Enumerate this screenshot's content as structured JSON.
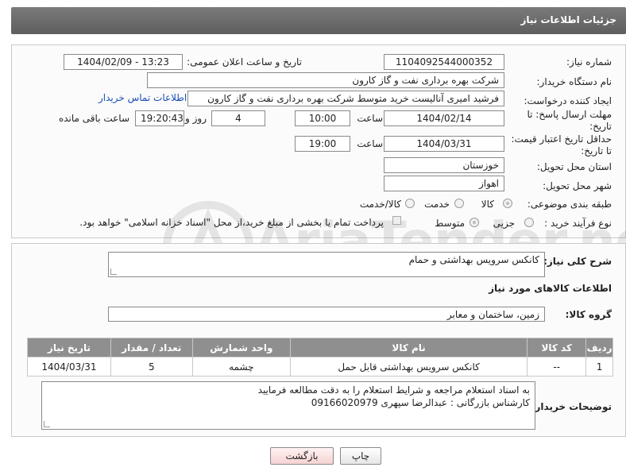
{
  "header": {
    "title": "جزئیات اطلاعات نیاز"
  },
  "form": {
    "need_number": {
      "label": "شماره نیاز:",
      "value": "1104092544000352"
    },
    "announce_datetime": {
      "label": "تاریخ و ساعت اعلان عمومی:",
      "value": "1404/02/09 - 13:23"
    },
    "buyer_org": {
      "label": "نام دستگاه خریدار:",
      "value": "شرکت بهره برداری نفت و گاز کارون"
    },
    "requester": {
      "label": "ایجاد کننده درخواست:",
      "value": "فرشید امیری آنالیست خرید متوسط شرکت بهره برداری نفت و گاز کارون"
    },
    "buyer_contact_link": "اطلاعات تماس خریدار",
    "reply_deadline": {
      "label": "مهلت ارسال پاسخ: تا تاریخ:",
      "date": "1404/02/14",
      "time_label": "ساعت",
      "time": "10:00",
      "days": "4",
      "days_label": "روز و",
      "remaining": "19:20:43",
      "remaining_label": "ساعت باقی مانده"
    },
    "price_validity": {
      "label": "حداقل تاریخ اعتبار قیمت: تا تاریخ:",
      "date": "1404/03/31",
      "time_label": "ساعت",
      "time": "19:00"
    },
    "province": {
      "label": "استان محل تحویل:",
      "value": "خوزستان"
    },
    "city": {
      "label": "شهر محل تحویل:",
      "value": "اهواز"
    },
    "category": {
      "label": "طبقه بندی موضوعی:",
      "options": [
        "کالا",
        "خدمت",
        "کالا/خدمت"
      ],
      "selected": "کالا"
    },
    "process_type": {
      "label": "نوع فرآیند خرید :",
      "options": [
        "جزیی",
        "متوسط"
      ],
      "selected": "متوسط",
      "payment_note": "پرداخت تمام یا بخشی از مبلغ خرید،از محل \"اسناد خزانه اسلامی\" خواهد بود."
    }
  },
  "description": {
    "label": "شرح کلی نیاز:",
    "value": "کانکس سرویس بهداشتی و حمام"
  },
  "goods_info_title": "اطلاعات کالاهای مورد نیاز",
  "goods_group": {
    "label": "گروه کالا:",
    "value": "زمین، ساختمان و معابر"
  },
  "table": {
    "headers": [
      "ردیف",
      "کد کالا",
      "نام کالا",
      "واحد شمارش",
      "تعداد / مقدار",
      "تاریخ نیاز"
    ],
    "rows": [
      [
        "1",
        "--",
        "کانکس سرویس بهداشتی قابل حمل",
        "چشمه",
        "5",
        "1404/03/31"
      ]
    ]
  },
  "buyer_notes": {
    "label": "توضیحات خریدار:",
    "line1": "به اسناد استعلام مراجعه و شرایط استعلام را به دقت مطالعه فرمایید",
    "line2": "کارشناس بازرگانی : عبدالرضا سپهری  09166020979"
  },
  "buttons": {
    "print": "چاپ",
    "back": "بازگشت"
  },
  "watermark": "AriaTender.neT"
}
